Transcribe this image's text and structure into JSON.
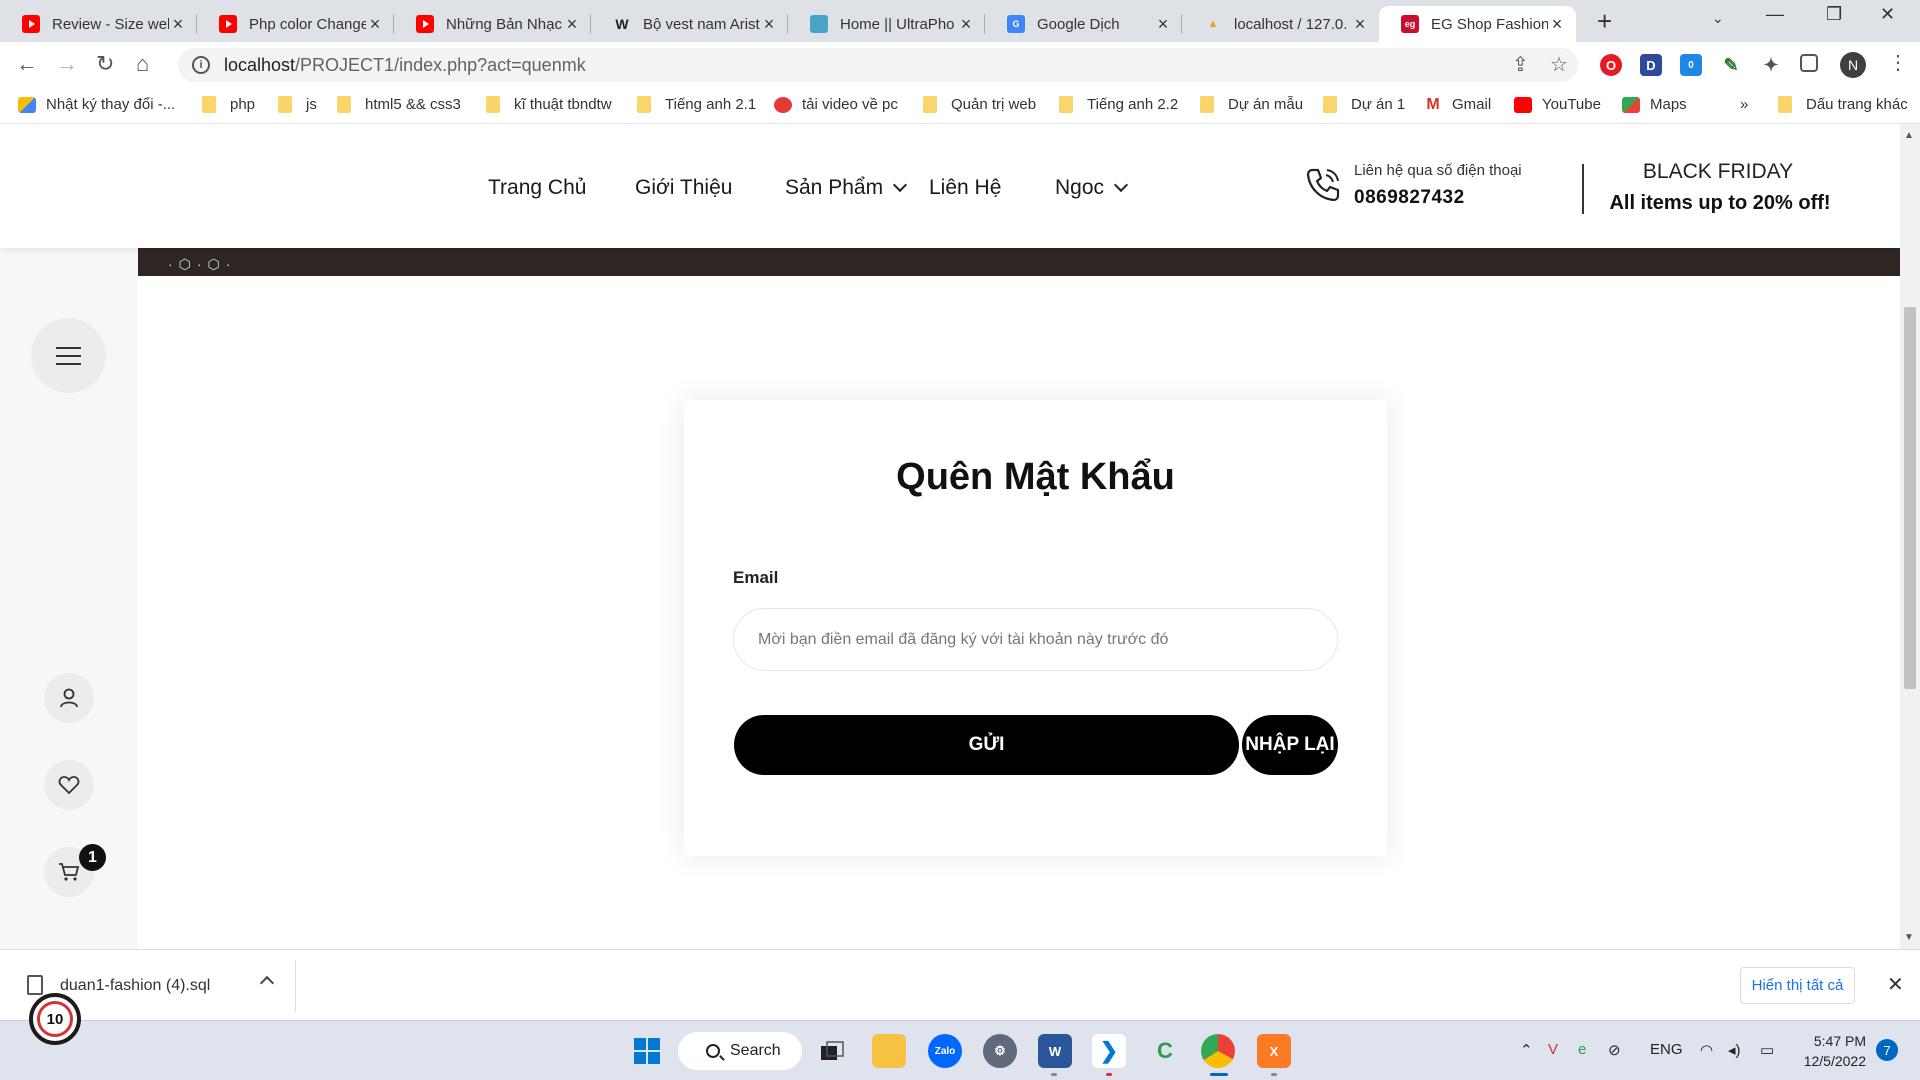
{
  "browser": {
    "tabs": [
      {
        "title": "Review - Size web",
        "icon": "youtube-icon",
        "active": false
      },
      {
        "title": "Php color Change",
        "icon": "youtube-icon",
        "active": false
      },
      {
        "title": "Những Bản Nhạc",
        "icon": "youtube-icon",
        "active": false
      },
      {
        "title": "Bộ vest nam Arist",
        "icon": "brand-w-icon",
        "active": false
      },
      {
        "title": "Home || UltraPho",
        "icon": "ultraphone-icon",
        "active": false
      },
      {
        "title": "Google Dịch",
        "icon": "google-translate-icon",
        "active": false
      },
      {
        "title": "localhost / 127.0.",
        "icon": "phpmyadmin-icon",
        "active": false
      },
      {
        "title": "EG Shop Fashion",
        "icon": "eg-shop-icon",
        "active": true
      }
    ],
    "url_host": "localhost",
    "url_path": "/PROJECT1/index.php?act=quenmk",
    "profile_initial": "N",
    "extension_badge": "0"
  },
  "bookmarks": [
    {
      "label": "Nhật ký thay đổi -...",
      "icon": "google-ads-icon"
    },
    {
      "label": "php",
      "icon": "folder-icon"
    },
    {
      "label": "js",
      "icon": "folder-icon"
    },
    {
      "label": "html5 && css3",
      "icon": "folder-icon"
    },
    {
      "label": "kĩ thuật tbndtw",
      "icon": "folder-icon"
    },
    {
      "label": "Tiếng anh 2.1",
      "icon": "folder-icon"
    },
    {
      "label": "tải video về pc",
      "icon": "4k-video-icon"
    },
    {
      "label": "Quản trị web",
      "icon": "folder-icon"
    },
    {
      "label": "Tiếng anh 2.2",
      "icon": "folder-icon"
    },
    {
      "label": "Dự án mẫu",
      "icon": "folder-icon"
    },
    {
      "label": "Dự án 1",
      "icon": "folder-icon"
    },
    {
      "label": "Gmail",
      "icon": "gmail-icon"
    },
    {
      "label": "YouTube",
      "icon": "youtube-icon"
    },
    {
      "label": "Maps",
      "icon": "maps-icon"
    }
  ],
  "bookmarks_more": "»",
  "bookmarks_other": "Dấu trang khác",
  "site": {
    "nav": {
      "home": "Trang Chủ",
      "about": "Giới Thiệu",
      "products": "Sản Phẩm",
      "contact": "Liên Hệ",
      "user": "Ngoc"
    },
    "contact_label": "Liên hệ qua số điện thoại",
    "contact_phone": "0869827432",
    "promo_title": "BLACK FRIDAY",
    "promo_sub": "All items up to 20% off!",
    "cart_count": "1"
  },
  "form": {
    "title": "Quên Mật Khẩu",
    "email_label": "Email",
    "email_placeholder": "Mời bạn điền email đã đăng ký với tài khoản này trước đó",
    "email_value": "",
    "submit_label": "GỬI",
    "reset_label": "NHẬP LẠI"
  },
  "download_bar": {
    "file_name": "duan1-fashion (4).sql",
    "show_all": "Hiển thị tất cả",
    "notification_count": "10"
  },
  "taskbar": {
    "search_label": "Search",
    "language": "ENG",
    "time": "5:47 PM",
    "date": "12/5/2022",
    "notifications": "7"
  },
  "colors": {
    "accent": "#000000",
    "tab_strip": "#dee1e6",
    "link_blue": "#1a73e8",
    "banner": "#2e2622"
  }
}
